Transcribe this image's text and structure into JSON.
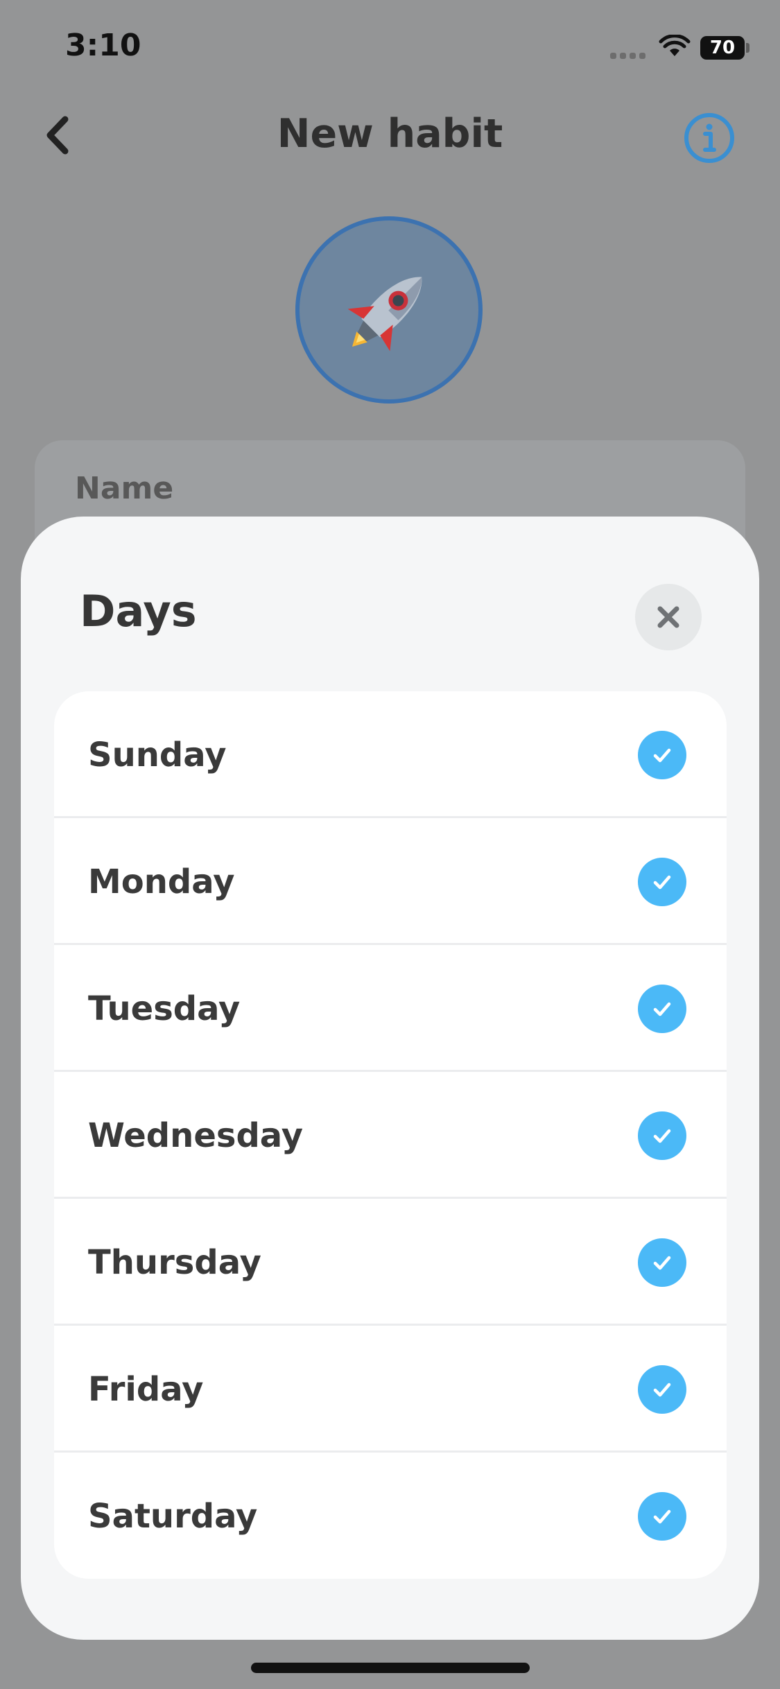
{
  "status_bar": {
    "time": "3:10",
    "battery": "70"
  },
  "header": {
    "title": "New habit",
    "back_icon": "chevron-left-icon",
    "info_icon": "info-circle-icon"
  },
  "habit": {
    "emoji": "🚀",
    "name_label": "Name"
  },
  "sheet": {
    "title": "Days",
    "close_icon": "close-icon",
    "days": [
      {
        "label": "Sunday",
        "checked": true
      },
      {
        "label": "Monday",
        "checked": true
      },
      {
        "label": "Tuesday",
        "checked": true
      },
      {
        "label": "Wednesday",
        "checked": true
      },
      {
        "label": "Thursday",
        "checked": true
      },
      {
        "label": "Friday",
        "checked": true
      },
      {
        "label": "Saturday",
        "checked": true
      }
    ]
  },
  "colors": {
    "accent": "#4bb9f7",
    "info": "#3a8fd1",
    "avatar_border": "#3c72b0"
  }
}
